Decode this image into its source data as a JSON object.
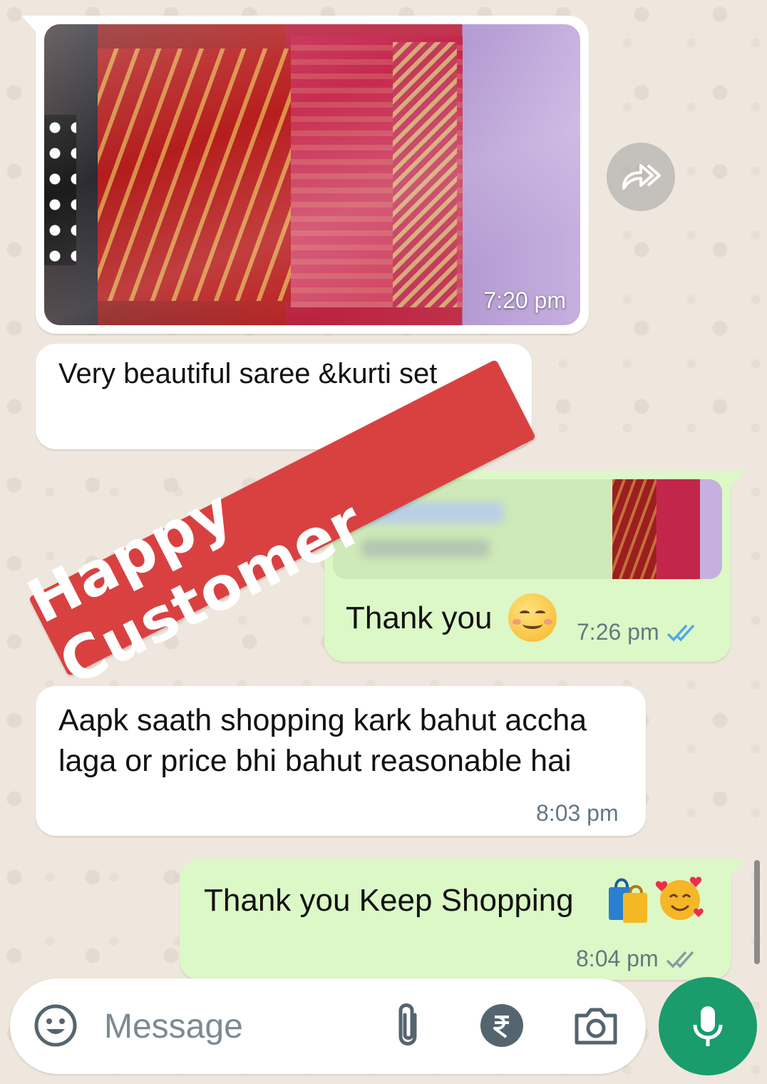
{
  "messages": {
    "image_time": "7:20 pm",
    "msg1_text": "Very beautiful saree &kurti set",
    "reply_text": "Thank you",
    "reply_time": "7:26 pm",
    "msg2_text": "Aapk saath shopping kark bahut accha laga or price bhi bahut reasonable hai",
    "msg2_time": "8:03 pm",
    "reply2_text": "Thank you Keep Shopping",
    "reply2_time": "8:04 pm"
  },
  "stamp": {
    "text": "Happy Customer",
    "color": "#d94141"
  },
  "input": {
    "placeholder": "Message"
  },
  "icons": {
    "forward": "forward-icon",
    "emoji": "emoji-icon",
    "attach": "paperclip-icon",
    "payment": "rupee-icon",
    "camera": "camera-icon",
    "mic": "mic-icon",
    "read": "double-check-icon"
  },
  "colors": {
    "outgoing_bubble": "#dcf8c6",
    "incoming_bubble": "#ffffff",
    "read_tick": "#4fa8e8",
    "mic_button": "#1a9c6c"
  }
}
